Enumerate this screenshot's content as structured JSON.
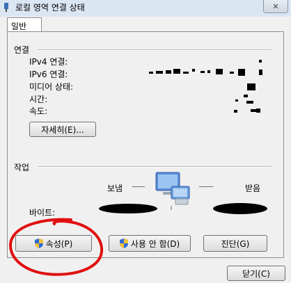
{
  "window": {
    "title": "로컬 영역 연결 상태",
    "close_glyph": "✕"
  },
  "tabs": [
    {
      "label": "일반"
    }
  ],
  "connection": {
    "heading": "연결",
    "rows": [
      {
        "label": "IPv4 연결:"
      },
      {
        "label": "IPv6 연결:"
      },
      {
        "label": "미디어 상태:"
      },
      {
        "label": "시간:"
      },
      {
        "label": "속도:"
      }
    ],
    "details_button": "자세히(E)..."
  },
  "activity": {
    "heading": "작업",
    "sent_label": "보냄",
    "received_label": "받음",
    "bytes_label": "바이트:"
  },
  "buttons": {
    "properties": "속성(P)",
    "disable": "사용 안 함(D)",
    "diagnose": "진단(G)",
    "close": "닫기(C)"
  },
  "colors": {
    "titlebar": "#dbe6f3",
    "annotation_red": "#e01010"
  },
  "icons": [
    "network-adapter-icon",
    "network-computers-icon",
    "shield-icon"
  ]
}
